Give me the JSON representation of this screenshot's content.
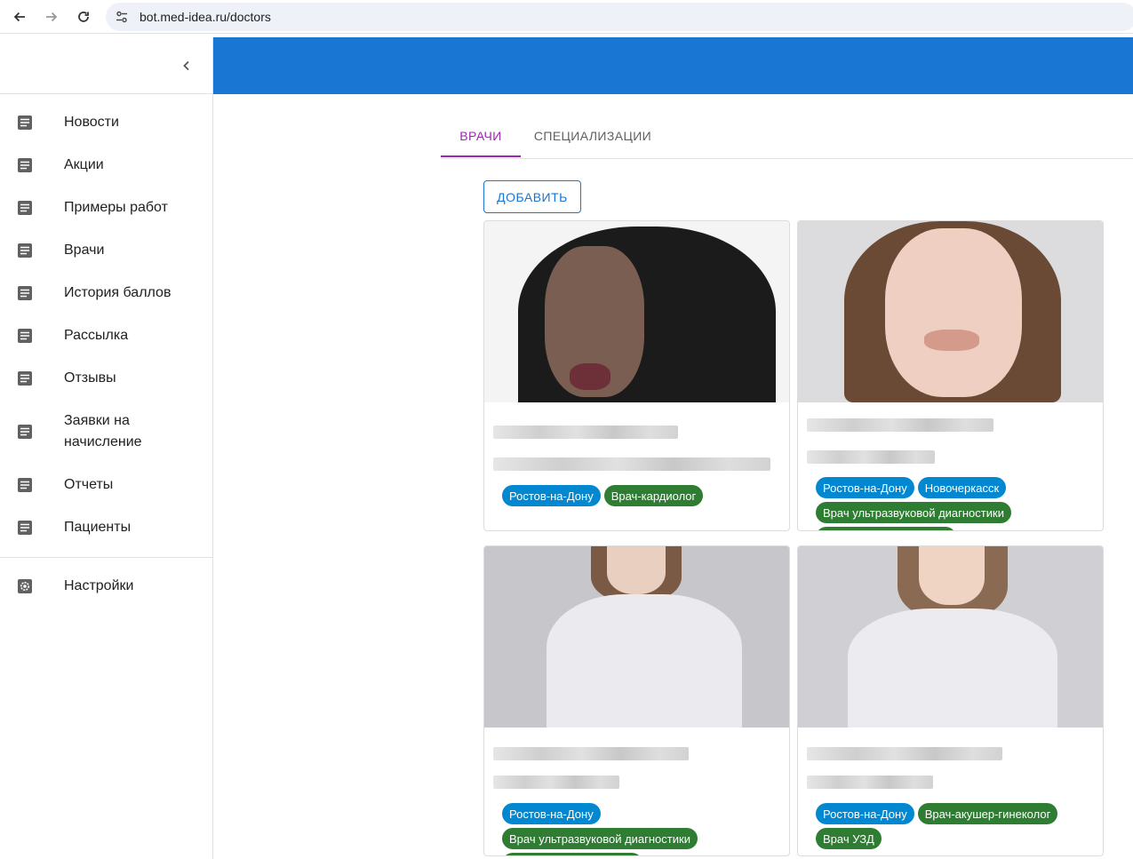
{
  "browser": {
    "url": "bot.med-idea.ru/doctors",
    "icons": [
      "back-arrow-icon",
      "forward-arrow-icon",
      "reload-icon",
      "site-settings-icon"
    ]
  },
  "sidebar": {
    "items": [
      {
        "label": "Новости",
        "icon": "document-icon"
      },
      {
        "label": "Акции",
        "icon": "document-icon"
      },
      {
        "label": "Примеры работ",
        "icon": "document-icon"
      },
      {
        "label": "Врачи",
        "icon": "document-icon"
      },
      {
        "label": "История баллов",
        "icon": "document-icon"
      },
      {
        "label": "Рассылка",
        "icon": "document-icon"
      },
      {
        "label": "Отзывы",
        "icon": "document-icon"
      },
      {
        "label": "Заявки на начисление",
        "icon": "document-icon"
      },
      {
        "label": "Отчеты",
        "icon": "document-icon"
      },
      {
        "label": "Пациенты",
        "icon": "document-icon"
      }
    ],
    "settings": {
      "label": "Настройки",
      "icon": "gear-icon"
    }
  },
  "colors": {
    "appbar": "#1976d2",
    "tab_active": "#9c27b0",
    "chip_city": "#0288d1",
    "chip_specialty": "#2e7d32"
  },
  "tabs": [
    {
      "label": "ВРАЧИ",
      "active": true
    },
    {
      "label": "СПЕЦИАЛИЗАЦИИ",
      "active": false
    }
  ],
  "add_button": "ДОБАВИТЬ",
  "cards": [
    {
      "chips": [
        {
          "type": "city",
          "label": "Ростов-на-Дону"
        },
        {
          "type": "spec",
          "label": "Врач-кардиолог"
        }
      ]
    },
    {
      "chips": [
        {
          "type": "city",
          "label": "Ростов-на-Дону"
        },
        {
          "type": "city",
          "label": "Новочеркасск"
        },
        {
          "type": "spec",
          "label": "Врач ультразвуковой диагностики"
        }
      ]
    },
    {
      "chips": [
        {
          "type": "city",
          "label": "Ростов-на-Дону"
        },
        {
          "type": "spec",
          "label": "Врач ультразвуковой диагностики"
        }
      ]
    },
    {
      "chips": [
        {
          "type": "city",
          "label": "Ростов-на-Дону"
        },
        {
          "type": "spec",
          "label": "Врач-акушер-гинеколог"
        },
        {
          "type": "spec",
          "label": "Врач УЗД"
        }
      ]
    }
  ]
}
